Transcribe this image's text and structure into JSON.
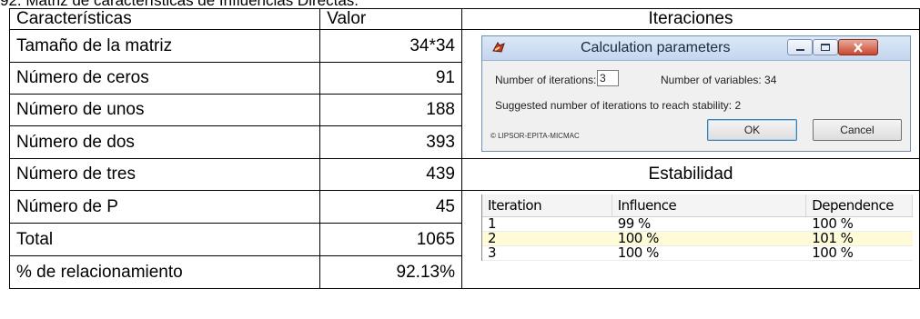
{
  "caption": "92. Matriz de características de Influencias Directas.",
  "table": {
    "headers": {
      "characteristics": "Características",
      "value": "Valor",
      "iterations": "Iteraciones",
      "stability": "Estabilidad"
    },
    "rows": [
      {
        "label": "Tamaño de la matriz",
        "value": "34*34"
      },
      {
        "label": "Número de ceros",
        "value": "91"
      },
      {
        "label": "Número de unos",
        "value": "188"
      },
      {
        "label": "Número de dos",
        "value": "393"
      },
      {
        "label": "Número de tres",
        "value": "439"
      },
      {
        "label": "Número de P",
        "value": "45"
      },
      {
        "label": "Total",
        "value": "1065"
      },
      {
        "label": "% de relacionamiento",
        "value": "92.13%"
      }
    ]
  },
  "dialog": {
    "title": "Calculation parameters",
    "iterations_label": "Number of iterations:",
    "iterations_value": "3",
    "variables_text": "Number of variables: 34",
    "suggested_text": "Suggested number of iterations to reach stability: 2",
    "copyright": "© LIPSOR-EPITA-MICMAC",
    "ok_label": "OK",
    "cancel_label": "Cancel"
  },
  "stability_grid": {
    "columns": [
      "Iteration",
      "Influence",
      "Dependence"
    ],
    "rows": [
      [
        "1",
        "99 %",
        "100 %"
      ],
      [
        "2",
        "100 %",
        "101 %"
      ],
      [
        "3",
        "100 %",
        "100 %"
      ]
    ],
    "selected_row_index": 1,
    "selected_row_color": "#fffbd6"
  }
}
